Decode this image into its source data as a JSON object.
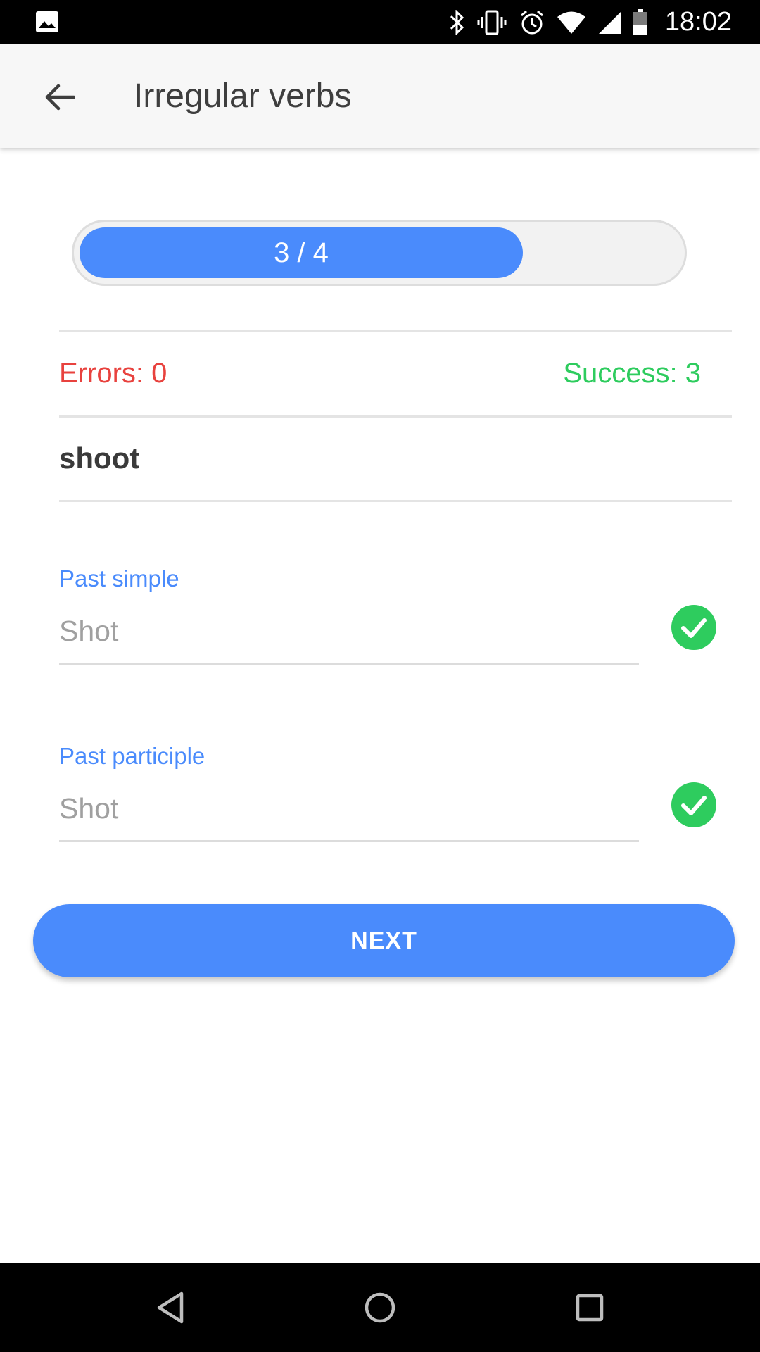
{
  "status_bar": {
    "time": "18:02",
    "icons": [
      "image-icon",
      "bluetooth-icon",
      "vibrate-icon",
      "alarm-icon",
      "wifi-icon",
      "signal-icon",
      "battery-icon"
    ]
  },
  "app_bar": {
    "title": "Irregular verbs",
    "back_icon": "arrow-back-icon"
  },
  "progress": {
    "label": "3 / 4",
    "current": 3,
    "total": 4,
    "fill_fraction": 0.74
  },
  "stats": {
    "errors_label": "Errors: 0",
    "success_label": "Success: 3"
  },
  "verb": "shoot",
  "fields": {
    "past_simple": {
      "label": "Past simple",
      "value": "Shot",
      "status_icon": "check-circle-icon"
    },
    "past_participle": {
      "label": "Past participle",
      "value": "Shot",
      "status_icon": "check-circle-icon"
    }
  },
  "next_button": {
    "label": "NEXT"
  },
  "nav_bar": {
    "icons": [
      "back-triangle-icon",
      "home-circle-icon",
      "recents-square-icon"
    ]
  },
  "colors": {
    "accent": "#4a8bfc",
    "error": "#e8423e",
    "success": "#2ecc5e"
  }
}
